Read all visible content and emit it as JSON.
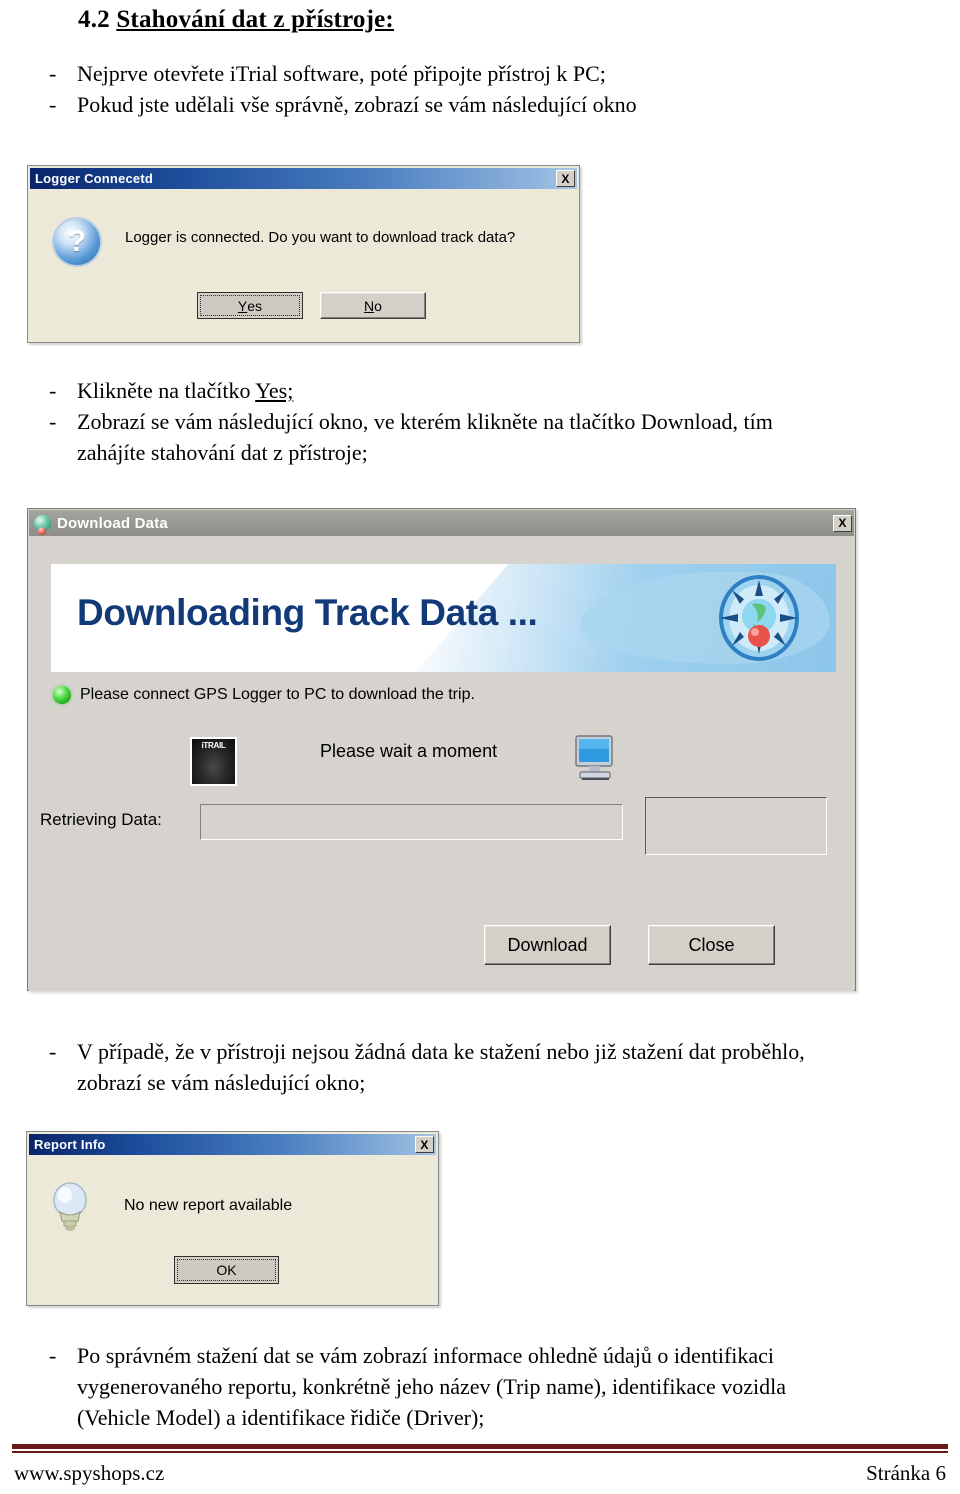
{
  "document": {
    "heading_number": "4.2",
    "heading_title": "Stahování dat z přístroje:",
    "bullets_top": [
      {
        "dash": "-",
        "text": "Nejprve otevřete iTrial  software, poté připojte  přístroj k PC;"
      },
      {
        "dash": "-",
        "text": "Pokud jste udělali  vše správně, zobrazí  se vám následující  okno"
      }
    ],
    "bullets_mid_1": {
      "dash": "-",
      "pre": "Klikněte  na tlačítko ",
      "link": "Yes;"
    },
    "bullets_mid_2": {
      "dash": "-",
      "line1": "Zobrazí  se vám následující  okno, ve kterém  klikněte  na tlačítko Download,  tím",
      "line2": "zahájíte  stahování  dat z přístroje;"
    },
    "bullets_mid_3": {
      "dash": "-",
      "line1": "V případě, že v přístroji  nejsou žádná  data ke stažení  nebo již stažení  dat proběhlo,",
      "line2": "zobrazí  se vám následující  okno;"
    },
    "bullets_bottom": {
      "dash": "-",
      "line1": "Po správném  stažení  dat se vám zobrazí  informace  ohledně  údajů o identifikaci",
      "line2": "vygenerovaného  reportu, konkrétně jeho název (Trip  name), identifikace  vozidla",
      "line3": "(Vehicle  Model) a identifikace  řidiče (Driver);"
    }
  },
  "dialog_logger": {
    "title": "Logger Connecetd",
    "icon": "question-mark-icon",
    "icon_glyph": "?",
    "message": "Logger is connected. Do you want to download track data?",
    "close_label": "X",
    "buttons": {
      "yes_accel": "Y",
      "yes_rest": "es",
      "no_accel": "N",
      "no_rest": "o"
    }
  },
  "dialog_download": {
    "title": "Download Data",
    "close_label": "X",
    "banner_title": "Downloading Track Data ...",
    "status_message": "Please connect GPS Logger to PC to download the trip.",
    "device_logo": "iTRAIL",
    "wait_message": "Please wait a moment",
    "progress_label": "Retrieving Data:",
    "progress_value": "",
    "count_value": "",
    "buttons": {
      "download": "Download",
      "close": "Close"
    }
  },
  "dialog_report": {
    "title": "Report Info",
    "icon": "light-bulb-icon",
    "message": "No new report available",
    "close_label": "X",
    "buttons": {
      "ok": "OK"
    }
  },
  "footer": {
    "site": "www.spyshops.cz",
    "page": "Stránka 6"
  },
  "colors": {
    "titlebar_blue_start": "#0a246a",
    "titlebar_blue_end": "#a6c6e6",
    "titlebar_gray": "#9a9a94",
    "dialog_face_xp": "#ece9d8",
    "dialog_face_classic": "#d6d3ce",
    "banner_text": "#123a79",
    "banner_accent": "#9fd0ee",
    "led_green": "#19a615",
    "footer_rule": "#6b1a1a"
  }
}
